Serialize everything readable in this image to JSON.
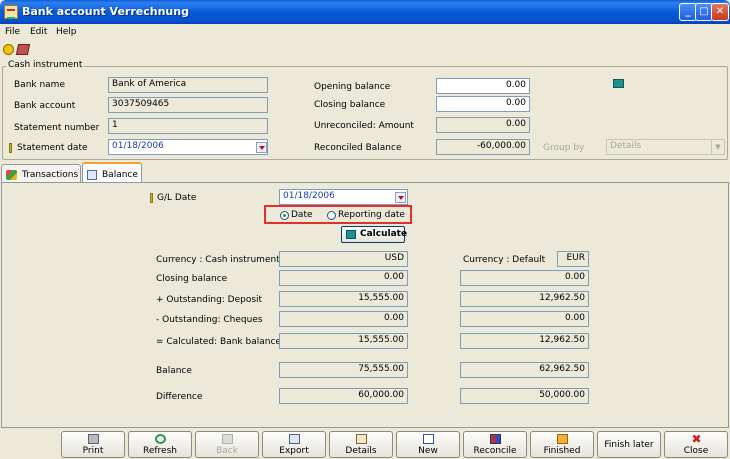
{
  "window": {
    "title": "Bank account Verrechnung"
  },
  "title_buttons": {
    "minimize": "_",
    "maximize": "□",
    "close": "✕"
  },
  "menu": [
    "File",
    "Edit",
    "Help"
  ],
  "cash_instrument": {
    "group_label": "Cash instrument",
    "bank_name_label": "Bank name",
    "bank_name": "Bank of America",
    "bank_account_label": "Bank account",
    "bank_account": "3037509465",
    "statement_number_label": "Statement number",
    "statement_number": "1",
    "statement_date_label": "Statement date",
    "statement_date": "01/18/2006",
    "opening_balance_label": "Opening balance",
    "opening_balance": "0.00",
    "closing_balance_label": "Closing balance",
    "closing_balance": "0.00",
    "unreconciled_label": "Unreconciled: Amount",
    "unreconciled": "0.00",
    "reconciled_label": "Reconciled Balance",
    "reconciled": "-60,000.00",
    "group_by_label": "Group by",
    "group_by": "Details"
  },
  "tabs": [
    {
      "label": "Transactions",
      "icon": "transactions-icon"
    },
    {
      "label": "Balance",
      "icon": "balance-icon",
      "active": true
    }
  ],
  "balance": {
    "gl_date_label": "G/L Date",
    "gl_date": "01/18/2006",
    "radio_date_label": "Date",
    "radio_reporting_label": "Reporting date",
    "calculate_label": "Calculate",
    "currency_cash_label": "Currency : Cash instrument",
    "currency_cash": "USD",
    "currency_default_label": "Currency : Default",
    "currency_default": "EUR",
    "closing_balance_label": "Closing balance",
    "outstanding_deposit_label": "+ Outstanding: Deposit",
    "outstanding_cheques_label": "- Outstanding: Cheques",
    "calculated_label": "= Calculated: Bank balance",
    "balance_label": "Balance",
    "difference_label": "Difference",
    "rows": {
      "closing": [
        "0.00",
        "0.00"
      ],
      "deposit": [
        "15,555.00",
        "12,962.50"
      ],
      "cheques": [
        "0.00",
        "0.00"
      ],
      "calculated": [
        "15,555.00",
        "12,962.50"
      ],
      "balance": [
        "75,555.00",
        "62,962.50"
      ],
      "difference": [
        "60,000.00",
        "50,000.00"
      ]
    }
  },
  "buttons": {
    "print": "Print",
    "refresh": "Refresh",
    "back": "Back",
    "export": "Export",
    "details": "Details",
    "new": "New",
    "reconcile": "Reconcile",
    "finished": "Finished",
    "finish_later": "Finish later",
    "close": "Close"
  },
  "colors": {
    "titlebar": "#0a5ad6",
    "highlight": "#e03030",
    "date_text": "#1a3cc8"
  }
}
